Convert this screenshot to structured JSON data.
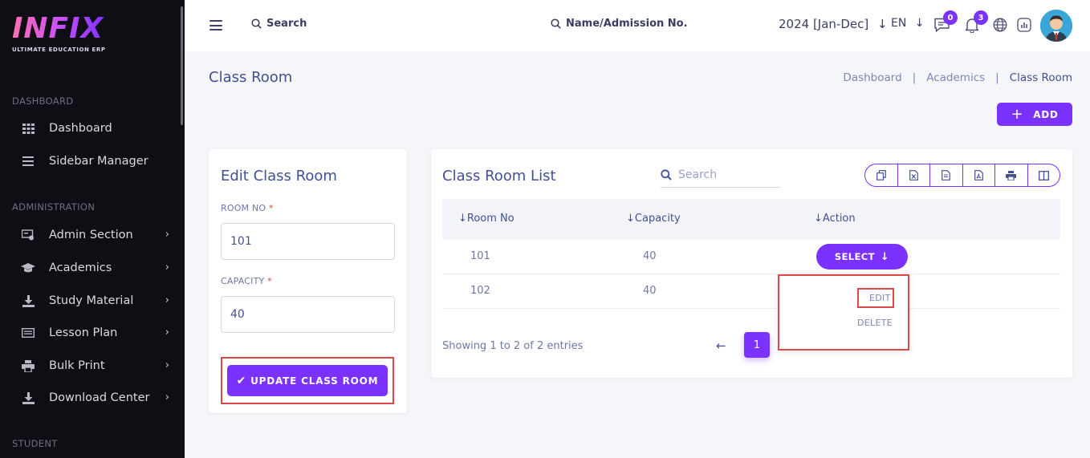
{
  "brand": {
    "logo_text": "INFIX",
    "tagline": "ULTIMATE EDUCATION ERP"
  },
  "sidebar": {
    "sections": [
      {
        "title": "DASHBOARD"
      },
      {
        "title": "ADMINISTRATION"
      },
      {
        "title": "STUDENT"
      }
    ],
    "items": [
      {
        "label": "Dashboard",
        "icon": "grid-icon"
      },
      {
        "label": "Sidebar Manager",
        "icon": "list-icon"
      },
      {
        "label": "Admin Section",
        "icon": "admin-icon"
      },
      {
        "label": "Academics",
        "icon": "graduation-cap-icon"
      },
      {
        "label": "Study Material",
        "icon": "download-icon"
      },
      {
        "label": "Lesson Plan",
        "icon": "document-icon"
      },
      {
        "label": "Bulk Print",
        "icon": "printer-icon"
      },
      {
        "label": "Download Center",
        "icon": "download-icon"
      }
    ]
  },
  "header": {
    "search_label": "Search",
    "student_search_label": "Name/Admission No.",
    "academic_year": "2024 [Jan-Dec]",
    "language": "EN",
    "messages_count": "0",
    "notifications_count": "3"
  },
  "page": {
    "title": "Class Room",
    "breadcrumb": [
      "Dashboard",
      "Academics",
      "Class Room"
    ],
    "add_label": "ADD"
  },
  "edit_form": {
    "title": "Edit Class Room",
    "room_no_label": "ROOM NO",
    "room_no_value": "101",
    "capacity_label": "CAPACITY",
    "capacity_value": "40",
    "required_mark": "*",
    "submit_label": "UPDATE CLASS ROOM"
  },
  "list": {
    "title": "Class Room List",
    "search_placeholder": "Search",
    "columns": [
      "Room No",
      "Capacity",
      "Action"
    ],
    "rows": [
      {
        "room_no": "101",
        "capacity": "40"
      },
      {
        "room_no": "102",
        "capacity": "40"
      }
    ],
    "select_label": "SELECT",
    "action_menu": [
      "EDIT",
      "DELETE"
    ],
    "footer": "Showing 1 to 2 of 2 entries",
    "current_page": "1"
  },
  "colors": {
    "accent": "#7c32ff",
    "sidebar_bg": "#0f0e14",
    "highlight": "#e04848",
    "text": "#415094"
  }
}
